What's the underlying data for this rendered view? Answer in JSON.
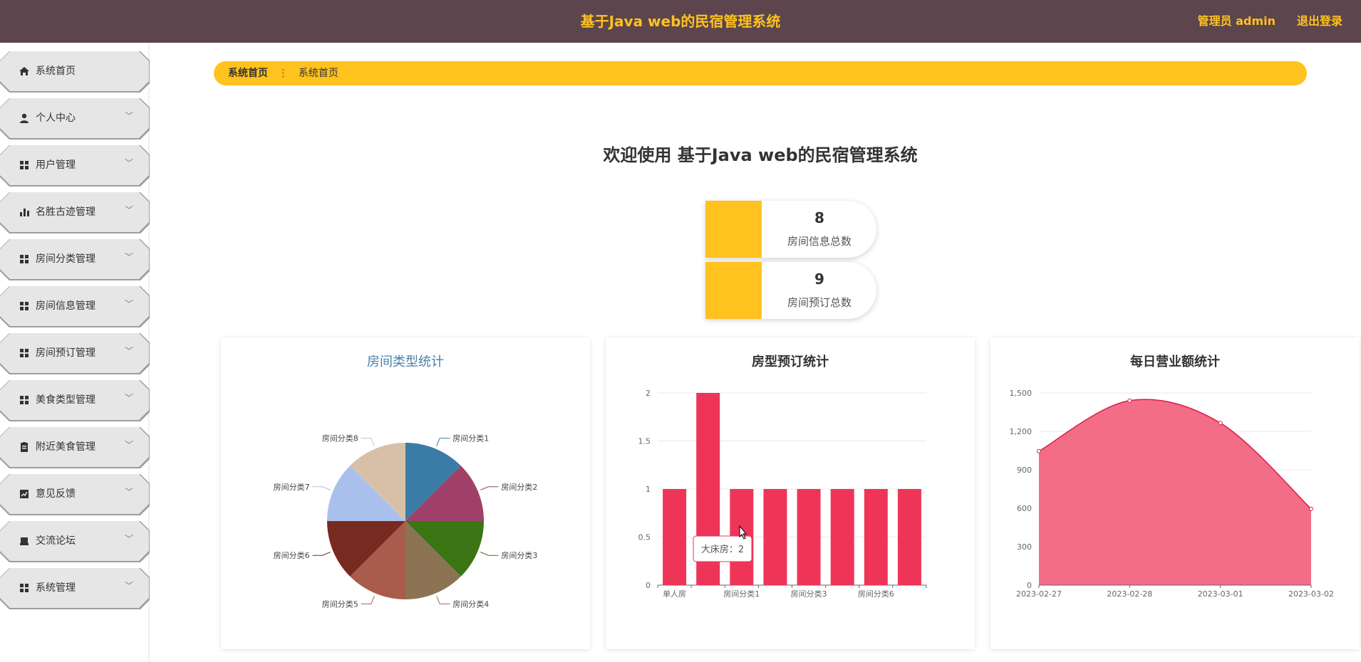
{
  "header": {
    "title": "基于Java web的民宿管理系统",
    "user": "管理员 admin",
    "logout": "退出登录"
  },
  "sidebar": {
    "items": [
      {
        "label": "系统首页",
        "icon": "home-icon"
      },
      {
        "label": "个人中心",
        "icon": "person-icon"
      },
      {
        "label": "用户管理",
        "icon": "grid-icon"
      },
      {
        "label": "名胜古迹管理",
        "icon": "bar-chart-icon"
      },
      {
        "label": "房间分类管理",
        "icon": "grid-icon"
      },
      {
        "label": "房间信息管理",
        "icon": "grid-icon"
      },
      {
        "label": "房间预订管理",
        "icon": "grid-icon"
      },
      {
        "label": "美食类型管理",
        "icon": "grid-icon"
      },
      {
        "label": "附近美食管理",
        "icon": "clipboard-icon"
      },
      {
        "label": "意见反馈",
        "icon": "trend-icon"
      },
      {
        "label": "交流论坛",
        "icon": "tray-icon"
      },
      {
        "label": "系统管理",
        "icon": "grid-icon"
      }
    ]
  },
  "breadcrumb": {
    "home": "系统首页",
    "separator": "⋮",
    "current": "系统首页"
  },
  "welcome": "欢迎使用 基于Java web的民宿管理系统",
  "stats": [
    {
      "value": "8",
      "label": "房间信息总数"
    },
    {
      "value": "9",
      "label": "房间预订总数"
    }
  ],
  "colors": {
    "header_bg": "#5c454c",
    "accent": "#ffc21f",
    "bar": "#ee3558",
    "area": "#f46d86"
  },
  "chart_data": [
    {
      "type": "pie",
      "title": "房间类型统计",
      "categories": [
        "房间分类1",
        "房间分类2",
        "房间分类3",
        "房间分类4",
        "房间分类5",
        "房间分类6",
        "房间分类7",
        "房间分类8"
      ],
      "values": [
        1,
        1,
        1,
        1,
        1,
        1,
        1,
        1
      ],
      "colors": [
        "#3a7ca5",
        "#a04068",
        "#3b7514",
        "#8c7354",
        "#a95c4c",
        "#772a20",
        "#aac0ec",
        "#d8c0a8"
      ]
    },
    {
      "type": "bar",
      "title": "房型预订统计",
      "categories": [
        "单人房",
        "大床房",
        "房间分类1",
        "房间分类2",
        "房间分类3",
        "房间分类4",
        "房间分类6",
        "房间分类8"
      ],
      "values": [
        1,
        2,
        1,
        1,
        1,
        1,
        1,
        1
      ],
      "ylim": [
        0,
        2
      ],
      "yticks": [
        0,
        0.5,
        1,
        1.5,
        2
      ],
      "ytick_labels": [
        "0",
        "0.5",
        "1",
        "1.5",
        "2"
      ],
      "xtick_labels": [
        "单人房",
        "",
        "房间分类1",
        "",
        "房间分类3",
        "",
        "房间分类6",
        ""
      ],
      "tooltip": "大床房：2"
    },
    {
      "type": "area",
      "title": "每日营业额统计",
      "x": [
        "2023-02-27",
        "2023-02-28",
        "2023-03-01",
        "2023-03-02"
      ],
      "values": [
        1045,
        1440,
        1265,
        595
      ],
      "ylim": [
        0,
        1500
      ],
      "yticks": [
        0,
        300,
        600,
        900,
        1200,
        1500
      ],
      "ytick_labels": [
        "0",
        "300",
        "600",
        "900",
        "1,200",
        "1,500"
      ]
    }
  ]
}
